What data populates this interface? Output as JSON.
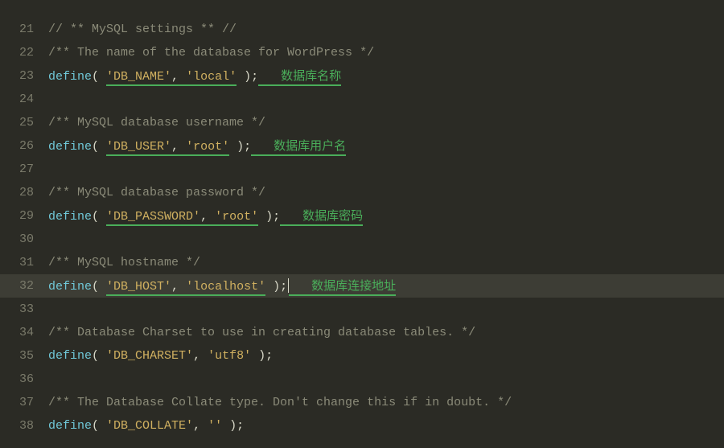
{
  "lines": {
    "21": {
      "comment": "// ** MySQL settings ** //"
    },
    "22": {
      "comment": "/** The name of the database for WordPress */"
    },
    "23": {
      "func": "define",
      "key": "'DB_NAME'",
      "val": "'local'",
      "label": "数据库名称"
    },
    "24": {},
    "25": {
      "comment": "/** MySQL database username */"
    },
    "26": {
      "func": "define",
      "key": "'DB_USER'",
      "val": "'root'",
      "label": "数据库用户名"
    },
    "27": {},
    "28": {
      "comment": "/** MySQL database password */"
    },
    "29": {
      "func": "define",
      "key": "'DB_PASSWORD'",
      "val": "'root'",
      "label": "数据库密码"
    },
    "30": {},
    "31": {
      "comment": "/** MySQL hostname */"
    },
    "32": {
      "func": "define",
      "key": "'DB_HOST'",
      "val": "'localhost'",
      "label": "数据库连接地址"
    },
    "33": {},
    "34": {
      "comment": "/** Database Charset to use in creating database tables. */"
    },
    "35": {
      "func": "define",
      "key": "'DB_CHARSET'",
      "val": "'utf8'"
    },
    "36": {},
    "37": {
      "comment": "/** The Database Collate type. Don't change this if in doubt. */"
    },
    "38": {
      "func": "define",
      "key": "'DB_COLLATE'",
      "val": "''"
    }
  },
  "linenos": {
    "21": "21",
    "22": "22",
    "23": "23",
    "24": "24",
    "25": "25",
    "26": "26",
    "27": "27",
    "28": "28",
    "29": "29",
    "30": "30",
    "31": "31",
    "32": "32",
    "33": "33",
    "34": "34",
    "35": "35",
    "36": "36",
    "37": "37",
    "38": "38"
  },
  "paren_open": "( ",
  "paren_close": " )",
  "comma": ", ",
  "semi": ";"
}
